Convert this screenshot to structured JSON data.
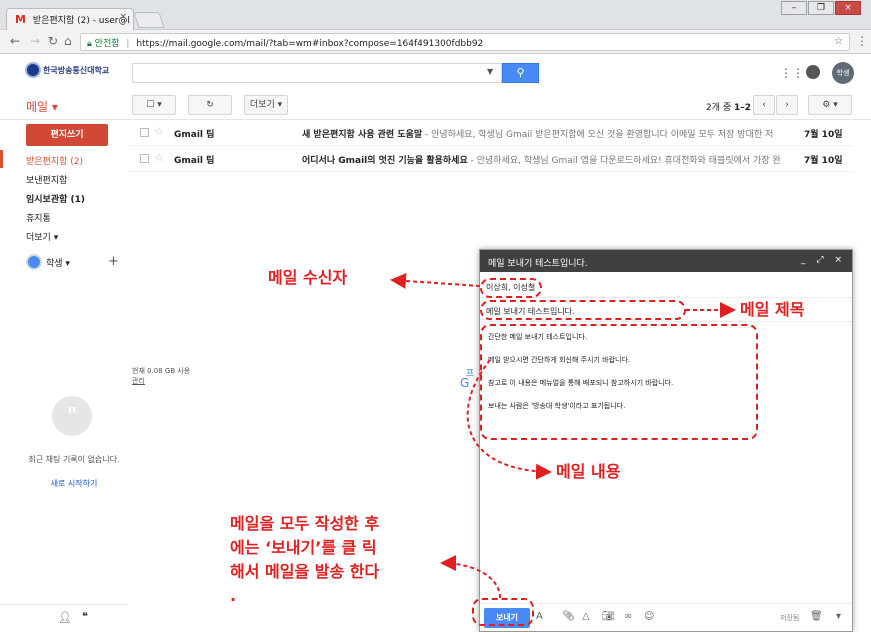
{
  "browser": {
    "tab_title": "받은편지함 (2) - user@l",
    "tab_gmail_mark": "M",
    "secure_label": "안전함",
    "url": "https://mail.google.com/mail/?tab=wm#inbox?compose=164f491300fdbb92"
  },
  "header": {
    "logo_text": "한국방송통신대학교",
    "avatar_text": "학생"
  },
  "toolbar": {
    "mail_label": "메일 ▾",
    "more_label": "더보기 ▾",
    "count_prefix": "2개 중",
    "count_range": "1–2"
  },
  "sidebar": {
    "compose_label": "편지쓰기",
    "items": [
      {
        "label": "받은편지함 (2)"
      },
      {
        "label": "보낸편지함"
      },
      {
        "label": "임시보관함 (1)"
      },
      {
        "label": "휴지통"
      },
      {
        "label": "더보기 ▾"
      }
    ],
    "hangout_user": "학생 ▾",
    "no_chat_text": "최근 채팅 기록이 없습니다.",
    "new_chat_link": "새로 시작하기"
  },
  "emails": [
    {
      "sender": "Gmail 팀",
      "subject": "새 받은편지함 사용 관련 도움말",
      "snippet": " - 안녕하세요, 학생님 Gmail 받은편지함에 오신 것을 환영합니다 이메일 모두 저장 방대한 저",
      "date": "7월 10일"
    },
    {
      "sender": "Gmail 팀",
      "subject": "어디서나 Gmail의 멋진 기능을 활용하세요",
      "snippet": " - 안녕하세요, 학생님 Gmail 앱을 다운로드하세요! 휴대전화와 태블릿에서 가장 완",
      "date": "7월 10일"
    }
  ],
  "storage": {
    "usage": "현재 0.08 GB 사용",
    "manage": "관리"
  },
  "compose": {
    "header_title": "메일 보내기 테스트입니다.",
    "recipients": "이상희, 이성철",
    "subject": "메일 보내기 테스트입니다.",
    "body": [
      "간단한 메일 보내기 테스트입니다.",
      "메일 받으시면 간단하게 회신해 주시기 바랍니다.",
      "참고로 이 내용은 메뉴얼을 통해 배포되니 참고하시기 바랍니다.",
      "보내는 사람은 '방송대 학생'이라고 표기됩니다."
    ],
    "send_label": "보내기",
    "saved_label": "저장됨"
  },
  "annotations": {
    "recipient": "메일 수신자",
    "subject": "메일 제목",
    "content": "메일 내용",
    "send_line1": "메일을 모두 작성한  후",
    "send_line2": "에는 ‘보내기’를 클  릭",
    "send_line3": "해서 메일을 발송  한다",
    "send_line4": ".",
    "color": "#e02020"
  }
}
